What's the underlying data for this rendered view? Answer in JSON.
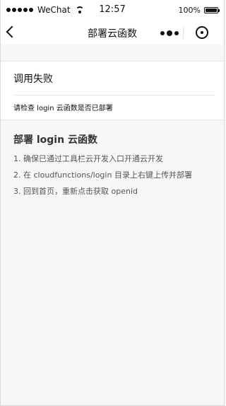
{
  "status_bar": {
    "carrier": "WeChat",
    "time": "12:57",
    "battery_percent": "100%",
    "battery_level": 1.0
  },
  "nav_bar": {
    "title": "部署云函数"
  },
  "error_card": {
    "title": "调用失败",
    "message": "请检查 login 云函数是否已部署"
  },
  "instructions": {
    "title": "部署 login 云函数",
    "steps": [
      "1. 确保已通过工具栏云开发入口开通云开发",
      "2. 在 cloudfunctions/login 目录上右键上传并部署",
      "3. 回到首页，重新点击获取 openid"
    ]
  }
}
